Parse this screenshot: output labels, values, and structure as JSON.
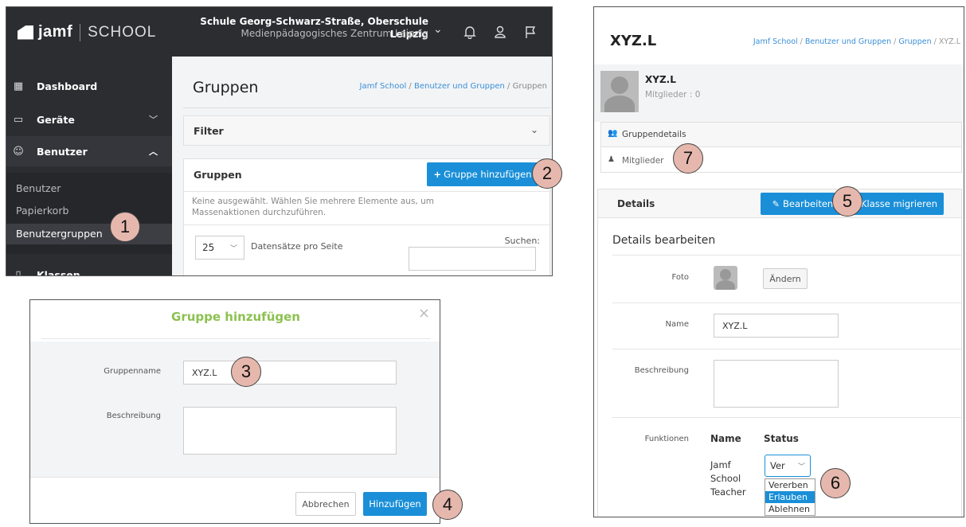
{
  "panel1": {
    "brand": "jamf",
    "brand_sub": "SCHOOL",
    "school_name": "Schule Georg-Schwarz-Straße, Oberschule Leipzig",
    "school_sub": "Medienpädagogisches Zentrum Leipzig",
    "sidebar": {
      "dashboard": "Dashboard",
      "devices": "Geräte",
      "users": "Benutzer",
      "sub_users": "Benutzer",
      "sub_trash": "Papierkorb",
      "sub_groups": "Benutzergruppen",
      "classes": "Klassen"
    },
    "page_title": "Gruppen",
    "breadcrumb": [
      "Jamf School",
      "Benutzer und Gruppen",
      "Gruppen"
    ],
    "filter_label": "Filter",
    "groups_card_title": "Gruppen",
    "add_group_button": "Gruppe hinzufügen",
    "none_selected_text": "Keine ausgewählt. Wählen Sie mehrere Elemente aus, um Massenaktionen durchzuführen.",
    "per_page_value": "25",
    "per_page_label": "Datensätze pro Seite",
    "search_label": "Suchen:"
  },
  "modal": {
    "title": "Gruppe hinzufügen",
    "group_name_label": "Gruppenname",
    "group_name_value": "XYZ.L",
    "description_label": "Beschreibung",
    "cancel_button": "Abbrechen",
    "add_button": "Hinzufügen"
  },
  "panel3": {
    "title": "XYZ.L",
    "breadcrumb": [
      "Jamf School",
      "Benutzer und Gruppen",
      "Gruppen",
      "XYZ.L"
    ],
    "group_name": "XYZ.L",
    "members_count": "Mitglieder : 0",
    "tab_details": "Gruppendetails",
    "tab_members": "Mitglieder",
    "details_title": "Details",
    "edit_button": "Bearbeiten",
    "migrate_button": "Klasse migrieren",
    "edit_details_title": "Details bearbeiten",
    "photo_label": "Foto",
    "change_button": "Ändern",
    "name_label": "Name",
    "name_value": "XYZ.L",
    "description_label": "Beschreibung",
    "functions_label": "Funktionen",
    "col_name": "Name",
    "col_status": "Status",
    "function_name_lines": [
      "Jamf",
      "School",
      "Teacher"
    ],
    "status_select_value": "Ver",
    "status_options": [
      "Vererben",
      "Erlauben",
      "Ablehnen"
    ]
  },
  "callouts": [
    "1",
    "2",
    "3",
    "4",
    "5",
    "6",
    "7"
  ]
}
